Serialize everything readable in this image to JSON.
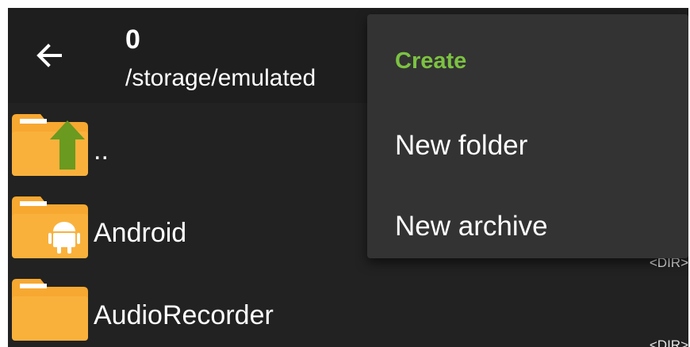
{
  "header": {
    "title": "0",
    "path": "/storage/emulated"
  },
  "files": [
    {
      "name": "..",
      "icon": "folder-up-icon",
      "meta": ""
    },
    {
      "name": "Android",
      "icon": "folder-android-icon",
      "meta": "<DIR>"
    },
    {
      "name": "AudioRecorder",
      "icon": "folder-icon",
      "meta": "<DIR>"
    }
  ],
  "menu": {
    "title": "Create",
    "items": [
      "New folder",
      "New archive"
    ]
  },
  "colors": {
    "folder": "#f7a830",
    "folder_shade": "#e8922b",
    "accent_green": "#7cc242",
    "arrow_green": "#6a9a1f"
  }
}
